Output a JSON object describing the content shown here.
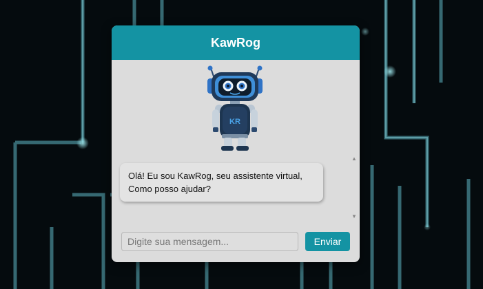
{
  "chat": {
    "title": "KawRog",
    "messages": [
      {
        "sender": "bot",
        "text": "Olá! Eu sou KawRog, seu assistente virtual, Como posso ajudar?"
      }
    ],
    "input": {
      "placeholder": "Digite sua mensagem...",
      "value": ""
    },
    "send_label": "Enviar"
  },
  "robot": {
    "chest_logo": "KR"
  },
  "colors": {
    "accent": "#1493a3",
    "panel": "#dcdcdc",
    "background": "#04090c",
    "robot_blue": "#2f73c6"
  }
}
